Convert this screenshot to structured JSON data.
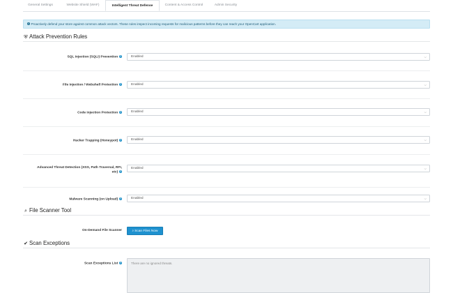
{
  "tabs": [
    {
      "label": "General Settings",
      "active": false
    },
    {
      "label": "Website Shield (WAF)",
      "active": false
    },
    {
      "label": "Intelligent Threat Defense",
      "active": true
    },
    {
      "label": "Content & Access Control",
      "active": false
    },
    {
      "label": "Admin Security",
      "active": false
    }
  ],
  "alert": {
    "icon": "info-circle-icon",
    "text": "Proactively defend your store against common attack vectors. These rules inspect incoming requests for malicious patterns before they can reach your OpenCart application."
  },
  "sections": {
    "attack": {
      "icon": "shield-icon",
      "title": "Attack Prevention Rules"
    },
    "scanner": {
      "icon": "search-icon",
      "title": "File Scanner Tool"
    },
    "exceptions": {
      "icon": "check-icon",
      "title": "Scan Exceptions"
    }
  },
  "rules": [
    {
      "label": "SQL Injection (SQLi) Prevention",
      "value": "Enabled"
    },
    {
      "label": "File Injection / Webshell Protection",
      "value": "Enabled"
    },
    {
      "label": "Code Injection Protection",
      "value": "Enabled"
    },
    {
      "label": "Hacker Trapping (Honeypot)",
      "value": "Enabled"
    },
    {
      "label_line1": "Advanced Threat Detection (XSS, Path Traversal, RFI,",
      "label_line2": "etc)",
      "value": "Enabled"
    },
    {
      "label": "Malware Scanning (on Upload)",
      "value": "Enabled"
    }
  ],
  "scanner": {
    "label": "On-Demand File Scanner",
    "button_label": "Scan Files Now"
  },
  "exceptions": {
    "label": "Scan Exceptions List",
    "value": "There are no ignored threats."
  },
  "colors": {
    "accent": "#1e91cf",
    "alert_bg": "#d4ecf6",
    "alert_text": "#1d5c78"
  }
}
